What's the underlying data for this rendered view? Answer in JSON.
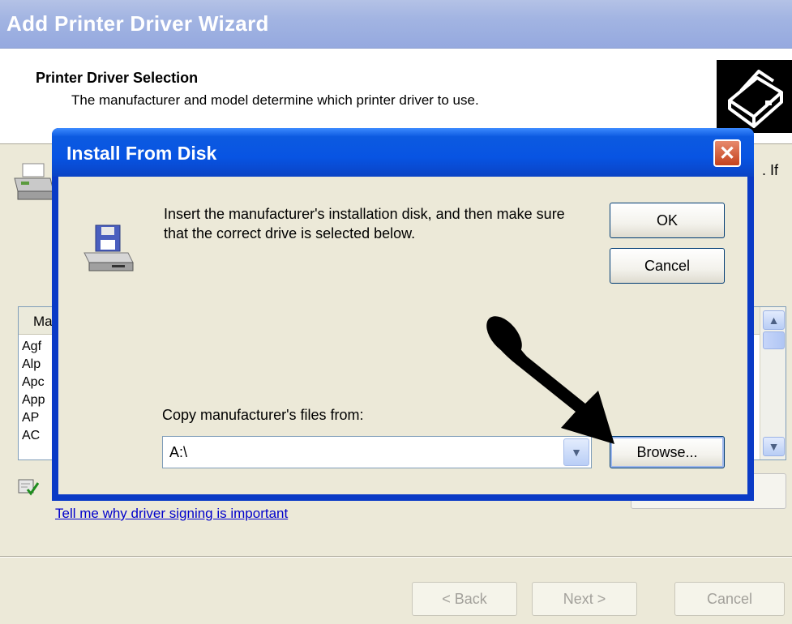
{
  "wizard": {
    "title": "Add Printer Driver Wizard",
    "header_title": "Printer Driver Selection",
    "header_subtitle": "The manufacturer and model determine which printer driver to use.",
    "body_text_fragment": ". If",
    "list_header": "Ma",
    "list_items": [
      "Agf",
      "Alp",
      "Apc",
      "App",
      "AP",
      "AC"
    ],
    "link_text": "Tell me why driver signing is important",
    "buttons": {
      "back": "< Back",
      "next": "Next >",
      "cancel": "Cancel"
    }
  },
  "dialog": {
    "title": "Install From Disk",
    "message": "Insert the manufacturer's installation disk, and then make sure that the correct drive is selected below.",
    "ok_label": "OK",
    "cancel_label": "Cancel",
    "copy_label": "Copy manufacturer's files from:",
    "copy_value": "A:\\",
    "browse_label": "Browse...",
    "close_glyph": "✕"
  },
  "icons": {
    "printer": "printer-icon",
    "floppy_drive": "floppy-drive-icon",
    "driver_signed": "driver-signed-icon",
    "arrow_annotation": "arrow-annotation-icon"
  }
}
